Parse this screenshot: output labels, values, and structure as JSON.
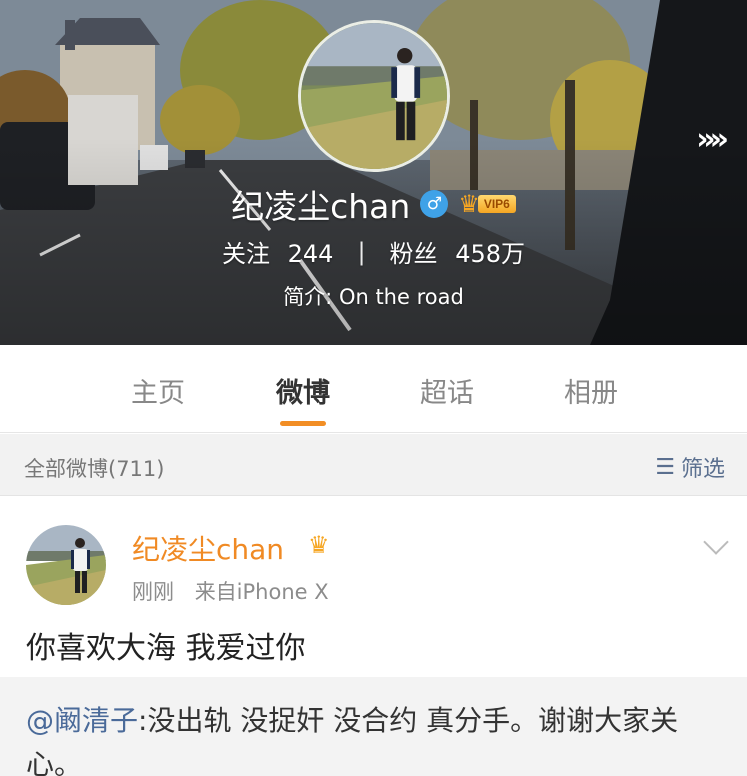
{
  "header": {
    "profile_name": "纪凌尘chan",
    "gender_symbol": "♂",
    "vip_label": "VIP6",
    "more_arrows": "»»",
    "stats": {
      "following_label": "关注",
      "following_value": "244",
      "separator": "|",
      "followers_label": "粉丝",
      "followers_value": "458万"
    },
    "bio": "简介: On the road"
  },
  "tabs": [
    {
      "label": "主页",
      "active": false
    },
    {
      "label": "微博",
      "active": true
    },
    {
      "label": "超话",
      "active": false
    },
    {
      "label": "相册",
      "active": false
    }
  ],
  "filter_bar": {
    "count_label": "全部微博(711)",
    "filter_label": "筛选"
  },
  "post": {
    "author": "纪凌尘chan",
    "time": "刚刚",
    "source": "来自iPhone X",
    "text": "你喜欢大海 我爱过你",
    "repost": {
      "mention": "@阚清子",
      "text": ":没出轨 没捉奸 没合约 真分手。谢谢大家关心。"
    }
  },
  "colors": {
    "accent_orange": "#f28e25",
    "link_blue": "#4a6a99",
    "author_orange": "#f08a24"
  }
}
